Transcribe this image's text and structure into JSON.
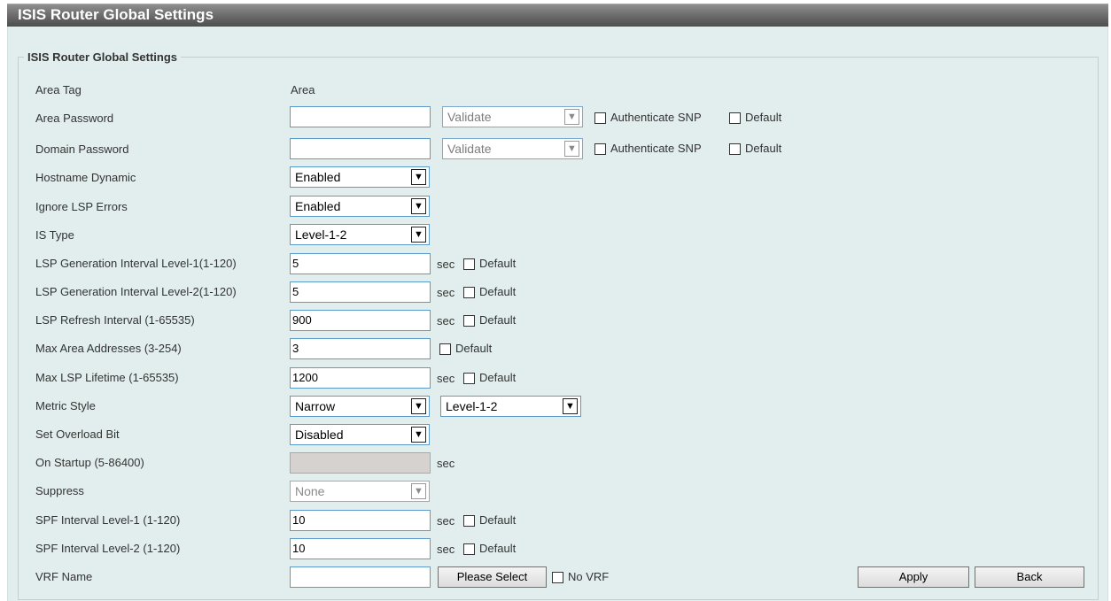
{
  "page": {
    "title": "ISIS Router Global Settings",
    "legend": "ISIS Router Global Settings"
  },
  "labels": {
    "area_tag": "Area Tag",
    "area_password": "Area Password",
    "domain_password": "Domain Password",
    "hostname_dynamic": "Hostname Dynamic",
    "ignore_lsp_errors": "Ignore LSP Errors",
    "is_type": "IS Type",
    "lsp_gen_l1": "LSP Generation Interval Level-1(1-120)",
    "lsp_gen_l2": "LSP Generation Interval Level-2(1-120)",
    "lsp_refresh": "LSP Refresh Interval (1-65535)",
    "max_area_addr": "Max Area Addresses (3-254)",
    "max_lsp_lifetime": "Max LSP Lifetime (1-65535)",
    "metric_style": "Metric Style",
    "set_overload_bit": "Set Overload Bit",
    "on_startup": "On Startup (5-86400)",
    "suppress": "Suppress",
    "spf_l1": "SPF Interval Level-1 (1-120)",
    "spf_l2": "SPF Interval Level-2 (1-120)",
    "vrf_name": "VRF Name"
  },
  "values": {
    "area_tag": "Area",
    "area_password": "",
    "area_password_mode": "Validate",
    "domain_password": "",
    "domain_password_mode": "Validate",
    "hostname_dynamic": "Enabled",
    "ignore_lsp_errors": "Enabled",
    "is_type": "Level-1-2",
    "lsp_gen_l1": "5",
    "lsp_gen_l2": "5",
    "lsp_refresh": "900",
    "max_area_addr": "3",
    "max_lsp_lifetime": "1200",
    "metric_style": "Narrow",
    "metric_level": "Level-1-2",
    "set_overload_bit": "Disabled",
    "on_startup": "",
    "suppress": "None",
    "spf_l1": "10",
    "spf_l2": "10",
    "vrf_name": ""
  },
  "text": {
    "authenticate_snp": "Authenticate SNP",
    "default": "Default",
    "sec": "sec",
    "no_vrf": "No VRF"
  },
  "buttons": {
    "please_select": "Please Select",
    "apply": "Apply",
    "back": "Back"
  },
  "icons": {
    "dropdown": "chevron-down-icon",
    "checkbox": "checkbox-unchecked"
  }
}
